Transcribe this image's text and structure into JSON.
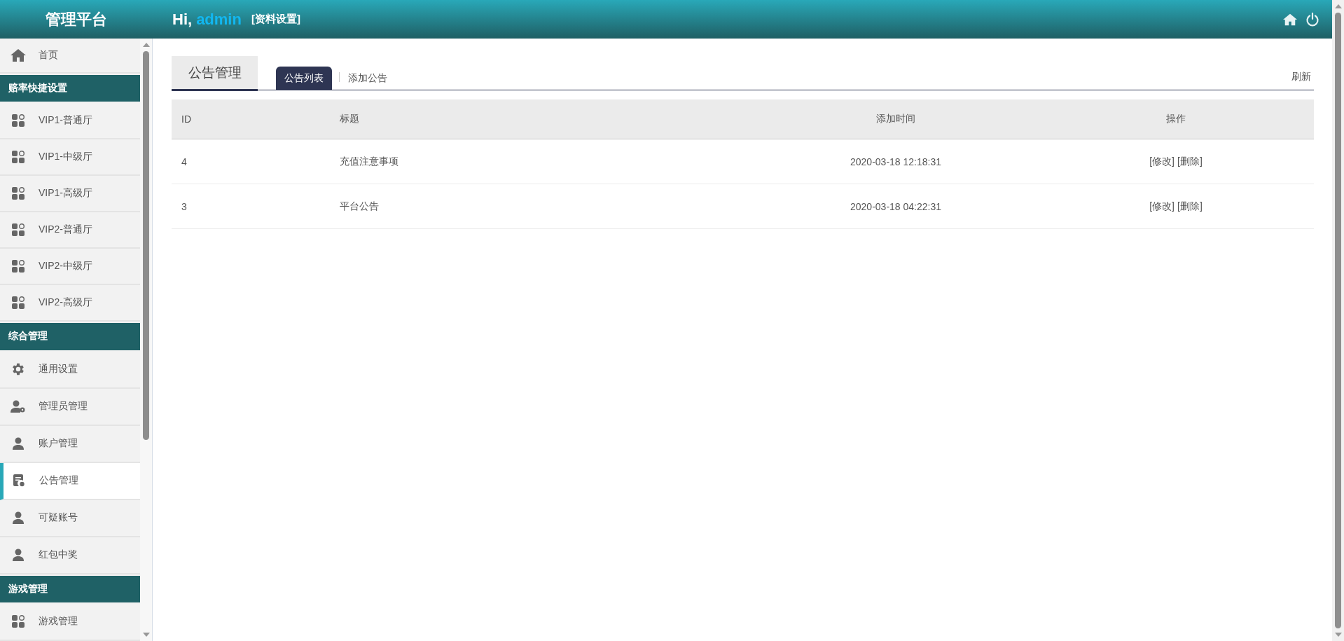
{
  "header": {
    "brand": "管理平台",
    "greeting": "Hi,",
    "user": "admin",
    "profile_link": "[资料设置]"
  },
  "sidebar": {
    "sections": [
      {
        "items": [
          {
            "label": "首页",
            "kind": "home",
            "selected": false
          }
        ]
      },
      {
        "title": "赔率快捷设置",
        "items": [
          {
            "label": "VIP1-普通厅",
            "kind": "apps",
            "selected": false
          },
          {
            "label": "VIP1-中级厅",
            "kind": "apps",
            "selected": false
          },
          {
            "label": "VIP1-高级厅",
            "kind": "apps",
            "selected": false
          },
          {
            "label": "VIP2-普通厅",
            "kind": "apps",
            "selected": false
          },
          {
            "label": "VIP2-中级厅",
            "kind": "apps",
            "selected": false
          },
          {
            "label": "VIP2-高级厅",
            "kind": "apps",
            "selected": false
          }
        ]
      },
      {
        "title": "综合管理",
        "items": [
          {
            "label": "通用设置",
            "kind": "gear",
            "selected": false
          },
          {
            "label": "管理员管理",
            "kind": "usergear",
            "selected": false
          },
          {
            "label": "账户管理",
            "kind": "user",
            "selected": false
          },
          {
            "label": "公告管理",
            "kind": "doc",
            "selected": true
          },
          {
            "label": "可疑账号",
            "kind": "user",
            "selected": false
          },
          {
            "label": "红包中奖",
            "kind": "user",
            "selected": false
          }
        ]
      },
      {
        "title": "游戏管理",
        "items": [
          {
            "label": "游戏管理",
            "kind": "apps",
            "selected": false
          }
        ]
      }
    ]
  },
  "content": {
    "page_title": "公告管理",
    "tabs": [
      {
        "label": "公告列表",
        "selected": true
      },
      {
        "label": "添加公告",
        "selected": false
      }
    ],
    "refresh": "刷新",
    "table": {
      "columns": [
        "ID",
        "标题",
        "添加时间",
        "操作"
      ],
      "rows": [
        {
          "id": "4",
          "title": "充值注意事项",
          "time": "2020-03-18 12:18:31",
          "actions": [
            "[修改]",
            "[删除]"
          ]
        },
        {
          "id": "3",
          "title": "平台公告",
          "time": "2020-03-18 04:22:31",
          "actions": [
            "[修改]",
            "[删除]"
          ]
        }
      ]
    }
  }
}
